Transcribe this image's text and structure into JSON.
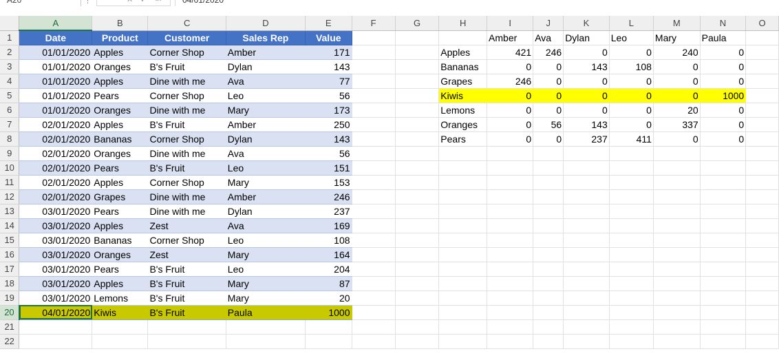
{
  "formula_bar": {
    "name_box": "A20",
    "formula": "04/01/2020"
  },
  "columns": [
    "A",
    "B",
    "C",
    "D",
    "E",
    "F",
    "G",
    "H",
    "I",
    "J",
    "K",
    "L",
    "M",
    "N",
    "O"
  ],
  "rows": [
    "1",
    "2",
    "3",
    "4",
    "5",
    "6",
    "7",
    "8",
    "9",
    "10",
    "11",
    "12",
    "13",
    "14",
    "15",
    "16",
    "17",
    "18",
    "19",
    "20",
    "21",
    "22"
  ],
  "table": {
    "headers": [
      "Date",
      "Product",
      "Customer",
      "Sales Rep",
      "Value"
    ],
    "rows": [
      [
        "01/01/2020",
        "Apples",
        "Corner Shop",
        "Amber",
        "171"
      ],
      [
        "01/01/2020",
        "Oranges",
        "B's Fruit",
        "Dylan",
        "143"
      ],
      [
        "01/01/2020",
        "Apples",
        "Dine with me",
        "Ava",
        "77"
      ],
      [
        "01/01/2020",
        "Pears",
        "Corner Shop",
        "Leo",
        "56"
      ],
      [
        "01/01/2020",
        "Oranges",
        "Dine with me",
        "Mary",
        "173"
      ],
      [
        "02/01/2020",
        "Apples",
        "B's Fruit",
        "Amber",
        "250"
      ],
      [
        "02/01/2020",
        "Bananas",
        "Corner Shop",
        "Dylan",
        "143"
      ],
      [
        "02/01/2020",
        "Oranges",
        "Dine with me",
        "Ava",
        "56"
      ],
      [
        "02/01/2020",
        "Pears",
        "B's Fruit",
        "Leo",
        "151"
      ],
      [
        "02/01/2020",
        "Apples",
        "Corner Shop",
        "Mary",
        "153"
      ],
      [
        "02/01/2020",
        "Grapes",
        "Dine with me",
        "Amber",
        "246"
      ],
      [
        "03/01/2020",
        "Pears",
        "Dine with me",
        "Dylan",
        "237"
      ],
      [
        "03/01/2020",
        "Apples",
        "Zest",
        "Ava",
        "169"
      ],
      [
        "03/01/2020",
        "Bananas",
        "Corner Shop",
        "Leo",
        "108"
      ],
      [
        "03/01/2020",
        "Oranges",
        "Zest",
        "Mary",
        "164"
      ],
      [
        "03/01/2020",
        "Pears",
        "B's Fruit",
        "Leo",
        "204"
      ],
      [
        "03/01/2020",
        "Apples",
        "B's Fruit",
        "Mary",
        "87"
      ],
      [
        "03/01/2020",
        "Lemons",
        "B's Fruit",
        "Mary",
        "20"
      ],
      [
        "04/01/2020",
        "Kiwis",
        "B's Fruit",
        "Paula",
        "1000"
      ]
    ]
  },
  "matrix": {
    "col_headers": [
      "Amber",
      "Ava",
      "Dylan",
      "Leo",
      "Mary",
      "Paula"
    ],
    "rows": [
      {
        "label": "Apples",
        "values": [
          "421",
          "246",
          "0",
          "0",
          "240",
          "0"
        ]
      },
      {
        "label": "Bananas",
        "values": [
          "0",
          "0",
          "143",
          "108",
          "0",
          "0"
        ]
      },
      {
        "label": "Grapes",
        "values": [
          "246",
          "0",
          "0",
          "0",
          "0",
          "0"
        ]
      },
      {
        "label": "Kiwis",
        "values": [
          "0",
          "0",
          "0",
          "0",
          "0",
          "1000"
        ]
      },
      {
        "label": "Lemons",
        "values": [
          "0",
          "0",
          "0",
          "0",
          "20",
          "0"
        ]
      },
      {
        "label": "Oranges",
        "values": [
          "0",
          "56",
          "143",
          "0",
          "337",
          "0"
        ]
      },
      {
        "label": "Pears",
        "values": [
          "0",
          "0",
          "237",
          "411",
          "0",
          "0"
        ]
      }
    ]
  },
  "colors": {
    "table_header": "#4472c4",
    "band": "#d9e1f2",
    "highlight_row": "#c9c900",
    "highlight_matrix": "#ffff00",
    "selection": "#217346"
  }
}
